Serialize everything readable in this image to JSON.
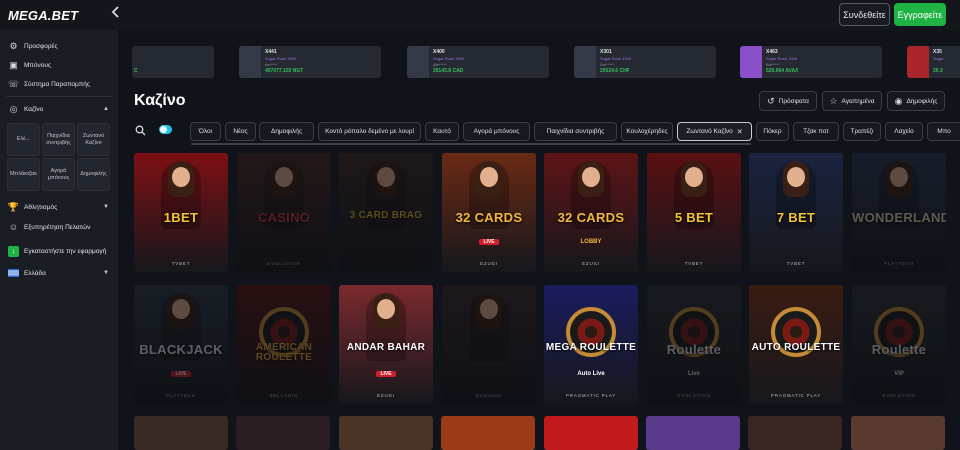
{
  "brand": {
    "logo": "MEGA.BET"
  },
  "header": {
    "login_label": "Συνδεθείτε",
    "register_label": "Εγγραφείτε"
  },
  "sidebar": {
    "items": [
      {
        "label": "Προσφορές",
        "icon": "gift-icon"
      },
      {
        "label": "Μπόνους",
        "icon": "bonus-icon"
      },
      {
        "label": "Σύστημα Παραπομπής",
        "icon": "referral-icon"
      },
      {
        "label": "Καζίνο",
        "icon": "casino-icon"
      },
      {
        "label": "Αθλητισμός",
        "icon": "trophy-icon"
      },
      {
        "label": "Εξυπηρέτηση Πελατών",
        "icon": "support-icon"
      },
      {
        "label": "Εγκαταστήστε την εφαρμογή",
        "icon": "app-install-icon"
      },
      {
        "label": "Ελλάδα",
        "icon": "greece-flag-icon"
      }
    ],
    "casino_sub": [
      "Ελέ...",
      "Παιχνίδια συντριβής",
      "Ζωντανό Καζίνο",
      "Μπλάκτζακ",
      "Αγορά μπόνους",
      "Δημοφιλής"
    ]
  },
  "jackpots": [
    {
      "multi": "",
      "game": "",
      "user": "",
      "amount": "C"
    },
    {
      "multi": "X441",
      "game": "Sugar Rush 1000",
      "user": "ria*****",
      "amount": "407077.102 NGT"
    },
    {
      "multi": "X400",
      "game": "Sugar Rush 1000",
      "user": "Ale*****",
      "amount": "26143.8 CAD"
    },
    {
      "multi": "X301",
      "game": "Sugar Rush 1000",
      "user": "Nic*****",
      "amount": "20524.6 CHF"
    },
    {
      "multi": "X463",
      "game": "Sugar Rush 1000",
      "user": "Ath*****",
      "amount": "520.064 AVAX"
    },
    {
      "multi": "X35",
      "game": "Sugar",
      "user": "",
      "amount": "20.3"
    }
  ],
  "main": {
    "title": "Καζίνο",
    "sort": {
      "recent": "Πρόσφατα",
      "favorites": "Αγαπημένα",
      "popular": "Δημοφιλής"
    },
    "categories": [
      "Όλοι",
      "Νέος",
      "Δημοφιλής",
      "Κοντό ρόπαλο δεμένο με λουρί",
      "Καυτό",
      "Αγορά μπόνους",
      "Παιχνίδια συντριβής",
      "Κουλοχέρηδες",
      "Ζωντανό Καζίνο",
      "Πόκερ",
      "Τζακ ποτ",
      "Τραπέζι",
      "Λαχείο",
      "Μπο"
    ],
    "active_category": "Ζωντανό Καζίνο"
  },
  "games": [
    {
      "name": "1BET",
      "sub": "",
      "provider": "TVBET",
      "dim": false,
      "bg": "#7d1014",
      "text": "#f2c531"
    },
    {
      "name": "CASINO",
      "sub": "",
      "provider": "EVOLUTION",
      "dim": true,
      "bg": "#4a2a22",
      "text": "#d13a3a"
    },
    {
      "name": "3 CARD BRAG",
      "sub": "",
      "provider": "",
      "dim": true,
      "bg": "#3e2a24",
      "text": "#e0b23a"
    },
    {
      "name": "32 CARDS",
      "sub": "LIVE",
      "provider": "EZUGI",
      "dim": false,
      "bg": "#6b2a14",
      "text": "#f3b83b"
    },
    {
      "name": "32 CARDS",
      "sub": "LOBBY",
      "provider": "EZUGI",
      "dim": false,
      "bg": "#5e1416",
      "text": "#f3b83b"
    },
    {
      "name": "5 BET",
      "sub": "",
      "provider": "TVBET",
      "dim": false,
      "bg": "#5a1012",
      "text": "#f2c531"
    },
    {
      "name": "7 BET",
      "sub": "",
      "provider": "TVBET",
      "dim": false,
      "bg": "#1a2440",
      "text": "#f2c531"
    },
    {
      "name": "WONDERLAND",
      "sub": "",
      "provider": "PLAYTECH",
      "dim": true,
      "bg": "#283a55",
      "text": "#e5d7b0"
    },
    {
      "name": "BLACKJACK",
      "sub": "LIVE",
      "provider": "PLAYTECH",
      "dim": true,
      "bg": "#2c3a44",
      "text": "#dfe6ea"
    },
    {
      "name": "AMERICAN ROULETTE",
      "sub": "",
      "provider": "BELLAGIO",
      "dim": true,
      "bg": "#5a1512",
      "text": "#f0a23c"
    },
    {
      "name": "ANDAR BAHAR",
      "sub": "LIVE",
      "provider": "EZUGI",
      "dim": false,
      "bg": "#7a2a2e",
      "text": "#ffffff"
    },
    {
      "name": "",
      "sub": "",
      "provider": "Evolution",
      "dim": true,
      "bg": "#3a2b2a",
      "text": "#ffffff"
    },
    {
      "name": "MEGA ROULETTE",
      "sub": "Auto Live",
      "provider": "PRAGMATIC PLAY",
      "dim": false,
      "bg": "#1a1c5e",
      "text": "#ffffff"
    },
    {
      "name": "Roulette",
      "sub": "Live",
      "provider": "EVOLUTION",
      "dim": true,
      "bg": "#2e3036",
      "text": "#dfe1e6"
    },
    {
      "name": "AUTO ROULETTE",
      "sub": "",
      "provider": "PRAGMATIC PLAY",
      "dim": false,
      "bg": "#3a1c12",
      "text": "#ffffff"
    },
    {
      "name": "Roulette",
      "sub": "VIP",
      "provider": "EVOLUTION",
      "dim": true,
      "bg": "#2e3036",
      "text": "#dfe1e6"
    }
  ],
  "colors": {
    "accent_green": "#1fb346",
    "brand_cyan": "#20c4e0",
    "live_red": "#d21d2b"
  }
}
